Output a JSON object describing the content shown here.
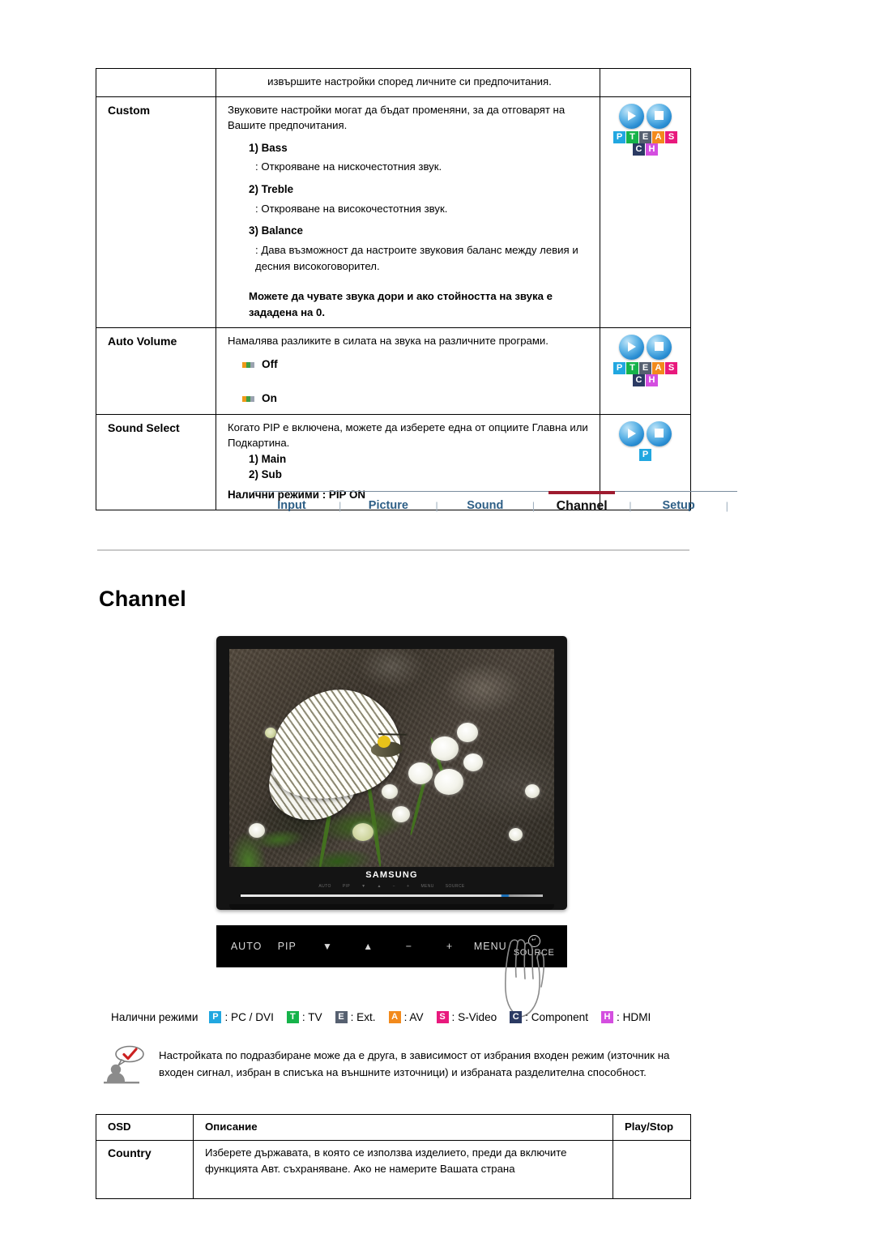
{
  "spec_table": {
    "lead_text": "извършите настройки според личните си предпочитания.",
    "rows": [
      {
        "osd": "Custom",
        "intro": "Звуковите настройки могат да бъдат променяни, за да отговарят на Вашите предпочитания.",
        "items": [
          {
            "head": "1) Bass",
            "desc": ": Открояване на нискочестотния звук."
          },
          {
            "head": "2) Treble",
            "desc": ": Открояване на високочестотния звук."
          },
          {
            "head": "3) Balance",
            "desc": ": Дава възможност да настроите звуковия баланс между левия и десния високоговорител."
          }
        ],
        "bold_note": "Можете да чувате звука дори и ако стойността на звука е зададена на 0.",
        "icons": {
          "orbs": [
            "play-icon",
            "stop-icon"
          ],
          "badges": [
            "P",
            "T",
            "E",
            "A",
            "S",
            "C",
            "H"
          ]
        }
      },
      {
        "osd": "Auto Volume",
        "intro": "Намалява разликите в силата на звука на различните програми.",
        "options": [
          "Off",
          "On"
        ],
        "icons": {
          "orbs": [
            "play-icon",
            "stop-icon"
          ],
          "badges": [
            "P",
            "T",
            "E",
            "A",
            "S",
            "C",
            "H"
          ]
        }
      },
      {
        "osd": "Sound Select",
        "intro": "Когато PIP е включена, можете да изберете една от опциите Главна или Подкартина.",
        "numbered": [
          "1) Main",
          "2) Sub"
        ],
        "available": "Налични режими : PIP ON",
        "icons": {
          "orbs": [
            "play-icon",
            "stop-icon"
          ],
          "badges": [
            "P"
          ]
        }
      }
    ]
  },
  "nav": {
    "tabs": [
      {
        "label": "Input",
        "active": false
      },
      {
        "label": "Picture",
        "active": false
      },
      {
        "label": "Sound",
        "active": false
      },
      {
        "label": "Channel",
        "active": true
      },
      {
        "label": "Setup",
        "active": false
      }
    ],
    "separator": "|",
    "active_underline_color": "#9e1b2f"
  },
  "page_title": "Channel",
  "monitor": {
    "brand": "SAMSUNG",
    "bezel_marks": [
      "AUTO",
      "PIP",
      "▼",
      "▲",
      "−",
      "+",
      "MENU",
      "SOURCE"
    ],
    "buttons": [
      "AUTO",
      "PIP",
      "▼",
      "▲",
      "−",
      "+",
      "MENU"
    ],
    "source_label": "SOURCE",
    "source_icon": "enter-icon"
  },
  "modes": {
    "label": "Налични режими",
    "items": [
      {
        "badge": "P",
        "text": ": PC / DVI",
        "color": "#21a7e0"
      },
      {
        "badge": "T",
        "text": ": TV",
        "color": "#16b34a"
      },
      {
        "badge": "E",
        "text": ": Ext.",
        "color": "#566070"
      },
      {
        "badge": "A",
        "text": ": AV",
        "color": "#f28a1c"
      },
      {
        "badge": "S",
        "text": ": S-Video",
        "color": "#e8197d"
      },
      {
        "badge": "C",
        "text": ": Component",
        "color": "#2b3a63"
      },
      {
        "badge": "H",
        "text": ": HDMI",
        "color": "#d44ee0"
      }
    ]
  },
  "note": {
    "icon": "person-note-icon",
    "text": "Настройката по подразбиране може да е друга, в зависимост от избрания входен режим (източник на входен сигнал, избран в списъка на външните източници) и избраната разделителна способност."
  },
  "bottom_table": {
    "headers": [
      "OSD",
      "Описание",
      "Play/Stop"
    ],
    "rows": [
      {
        "osd": "Country",
        "desc": "Изберете държавата, в която се използва изделието, преди да включите функцията Авт. съхраняване. Ако не намерите Вашата страна",
        "play": ""
      }
    ]
  }
}
